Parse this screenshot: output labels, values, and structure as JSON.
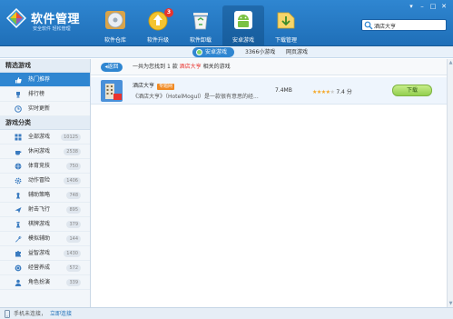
{
  "header": {
    "title": "软件管理",
    "subtitle": "安全软件 轻松管理",
    "nav": [
      {
        "label": "软件仓库",
        "icon": "disc-icon"
      },
      {
        "label": "软件升级",
        "icon": "upgrade-icon",
        "badge": "3"
      },
      {
        "label": "软件卸载",
        "icon": "recycle-bin-icon"
      },
      {
        "label": "安卓游戏",
        "icon": "android-icon",
        "active": true
      },
      {
        "label": "下载管理",
        "icon": "download-icon"
      }
    ],
    "window_controls": [
      "▾",
      "–",
      "□",
      "✕"
    ],
    "search": {
      "value": "酒店大亨"
    }
  },
  "subtabs": {
    "android": "安卓游戏",
    "small": "3366小游戏",
    "web": "网页游戏"
  },
  "sidebar": {
    "featured_title": "精选游戏",
    "featured": [
      {
        "label": "热门推荐",
        "icon": "thumb-up-icon",
        "active": true
      },
      {
        "label": "排行榜",
        "icon": "trophy-icon"
      },
      {
        "label": "实时更新",
        "icon": "clock-icon"
      }
    ],
    "category_title": "游戏分类",
    "categories": [
      {
        "label": "全部游戏",
        "count": "10125",
        "icon": "grid-icon"
      },
      {
        "label": "休闲游戏",
        "count": "2538",
        "icon": "teacup-icon"
      },
      {
        "label": "体育竞技",
        "count": "750",
        "icon": "ball-icon"
      },
      {
        "label": "动作冒险",
        "count": "1406",
        "icon": "gear-icon"
      },
      {
        "label": "辅助策略",
        "count": "748",
        "icon": "chess-icon"
      },
      {
        "label": "射击飞行",
        "count": "895",
        "icon": "plane-icon"
      },
      {
        "label": "棋牌游戏",
        "count": "379",
        "icon": "chess-piece-icon"
      },
      {
        "label": "模拟辅助",
        "count": "144",
        "icon": "wrench-icon"
      },
      {
        "label": "益智游戏",
        "count": "1430",
        "icon": "puzzle-icon"
      },
      {
        "label": "经营养成",
        "count": "572",
        "icon": "coin-icon"
      },
      {
        "label": "角色扮演",
        "count": "339",
        "icon": "user-icon"
      }
    ]
  },
  "results": {
    "back_label": "返回",
    "prefix": "一共为您找到",
    "count": "1",
    "middle": "款",
    "keyword": "酒店大亨",
    "suffix": "相关的游戏"
  },
  "apps": [
    {
      "name": "酒店大亨",
      "tag": "专题网",
      "description": "《酒店大亨》（HotelMogul）是一款很有意思的经...",
      "size": "7.4MB",
      "rating": "7.4 分",
      "stars": 4,
      "download_label": "下载"
    }
  ],
  "footer": {
    "status": "手机未连接，",
    "link": "立即连接"
  },
  "colors": {
    "header_blue": "#2f86d1",
    "accent_orange": "#f08a24",
    "download_green": "#93cf4f",
    "badge_red": "#e8332e"
  }
}
